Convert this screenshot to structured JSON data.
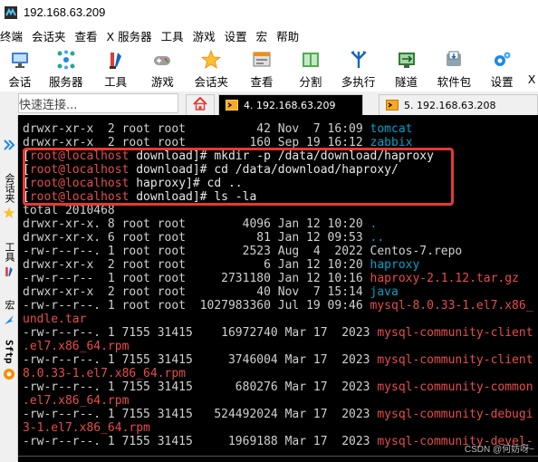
{
  "window": {
    "title": "192.168.63.209"
  },
  "menu": [
    "终端",
    "会话夹",
    "查看",
    "X 服务器",
    "工具",
    "游戏",
    "设置",
    "宏",
    "帮助"
  ],
  "toolbar": [
    {
      "label": "会话",
      "icon": "monitor-icon"
    },
    {
      "label": "服务器",
      "icon": "network-icon"
    },
    {
      "label": "工具",
      "icon": "tools-icon"
    },
    {
      "label": "游戏",
      "icon": "gamepad-icon"
    },
    {
      "label": "会话夹",
      "icon": "star-icon"
    },
    {
      "label": "查看",
      "icon": "view-icon"
    },
    {
      "label": "分割",
      "icon": "split-icon"
    },
    {
      "label": "多执行",
      "icon": "multiexec-icon"
    },
    {
      "label": "隧道",
      "icon": "tunnel-icon"
    },
    {
      "label": "软件包",
      "icon": "package-icon"
    },
    {
      "label": "设置",
      "icon": "gear-icon"
    },
    {
      "label": "X",
      "icon": "xserver-icon"
    }
  ],
  "quick_connect": {
    "placeholder": "快速连接..."
  },
  "tabs": [
    {
      "label": "4. 192.168.63.209",
      "active": true
    },
    {
      "label": "5. 192.168.63.208",
      "active": false
    }
  ],
  "sidebar": {
    "items": [
      {
        "label": "会话夹",
        "icon": "star-icon"
      },
      {
        "label": "工具",
        "icon": "tools-icon"
      },
      {
        "label": "宏",
        "icon": "macro-icon"
      },
      {
        "label": "Sftp",
        "icon": "sftp-icon"
      }
    ]
  },
  "terminal": {
    "lines": [
      [
        {
          "t": "drwxr-xr-x  2 root root          42 Nov  7 16:09 ",
          "c": "grey"
        },
        {
          "t": "tomcat",
          "c": "blue"
        }
      ],
      [
        {
          "t": "drwxr-xr-x  2 root root         160 Sep 19 16:12 ",
          "c": "grey"
        },
        {
          "t": "zabbix",
          "c": "blue"
        }
      ],
      [
        {
          "t": "[",
          "c": "white"
        },
        {
          "t": "root@localhost",
          "c": "host"
        },
        {
          "t": " download]# mkdir -p /data/download/haproxy",
          "c": "white"
        }
      ],
      [
        {
          "t": "[",
          "c": "white"
        },
        {
          "t": "root@localhost",
          "c": "host"
        },
        {
          "t": " download]# cd /data/download/haproxy/",
          "c": "white"
        }
      ],
      [
        {
          "t": "[",
          "c": "white"
        },
        {
          "t": "root@localhost",
          "c": "host"
        },
        {
          "t": " haproxy]# cd ..",
          "c": "white"
        }
      ],
      [
        {
          "t": "[",
          "c": "white"
        },
        {
          "t": "root@localhost",
          "c": "host"
        },
        {
          "t": " download]# ls -la",
          "c": "white"
        }
      ],
      [
        {
          "t": "total 2010468",
          "c": "grey"
        }
      ],
      [
        {
          "t": "drwxr-xr-x. 8 root root        4096 Jan 12 10:20 ",
          "c": "grey"
        },
        {
          "t": ".",
          "c": "blue"
        }
      ],
      [
        {
          "t": "drwxr-xr-x. 6 root root          81 Jan 12 09:53 ",
          "c": "grey"
        },
        {
          "t": "..",
          "c": "blue"
        }
      ],
      [
        {
          "t": "-rw-r--r--. 1 root root        2523 Aug  4  2022 Centos-7.repo",
          "c": "grey"
        }
      ],
      [
        {
          "t": "drwxr-xr-x  2 root root           6 Jan 12 10:20 ",
          "c": "grey"
        },
        {
          "t": "haproxy",
          "c": "blue"
        }
      ],
      [
        {
          "t": "-rw-r--r--  1 root root     2731180 Jan 12 10:16 ",
          "c": "grey"
        },
        {
          "t": "haproxy-2.1.12.tar.gz",
          "c": "red"
        }
      ],
      [
        {
          "t": "drwxr-xr-x  2 root root          40 Nov  7 15:14 ",
          "c": "grey"
        },
        {
          "t": "java",
          "c": "blue"
        }
      ],
      [
        {
          "t": "-rw-r--r--. 1 root root  1027983360 Jul 19 09:46 ",
          "c": "grey"
        },
        {
          "t": "mysql-8.0.33-1.el7.x86_",
          "c": "red"
        }
      ],
      [
        {
          "t": "undle.tar",
          "c": "red"
        }
      ],
      [
        {
          "t": "-rw-r--r--. 1 7155 31415    16972740 Mar 17  2023 ",
          "c": "grey"
        },
        {
          "t": "mysql-community-client",
          "c": "red"
        }
      ],
      [
        {
          "t": ".el7.x86_64.rpm",
          "c": "red"
        }
      ],
      [
        {
          "t": "-rw-r--r--. 1 7155 31415     3746004 Mar 17  2023 ",
          "c": "grey"
        },
        {
          "t": "mysql-community-client",
          "c": "red"
        }
      ],
      [
        {
          "t": "8.0.33-1.el7.x86_64.rpm",
          "c": "red"
        }
      ],
      [
        {
          "t": "-rw-r--r--. 1 7155 31415      680276 Mar 17  2023 ",
          "c": "grey"
        },
        {
          "t": "mysql-community-common",
          "c": "red"
        }
      ],
      [
        {
          "t": ".el7.x86_64.rpm",
          "c": "red"
        }
      ],
      [
        {
          "t": "-rw-r--r--. 1 7155 31415   524492024 Mar 17  2023 ",
          "c": "grey"
        },
        {
          "t": "mysql-community-debugi",
          "c": "red"
        }
      ],
      [
        {
          "t": "3-1.el7.x86_64.rpm",
          "c": "red"
        }
      ],
      [
        {
          "t": "-rw-r--r--. 1 7155 31415     1969188 Mar 17  2023 ",
          "c": "grey"
        },
        {
          "t": "mysql-community-devel-",
          "c": "red"
        }
      ]
    ]
  },
  "watermark": "CSDN @何妨呀~"
}
